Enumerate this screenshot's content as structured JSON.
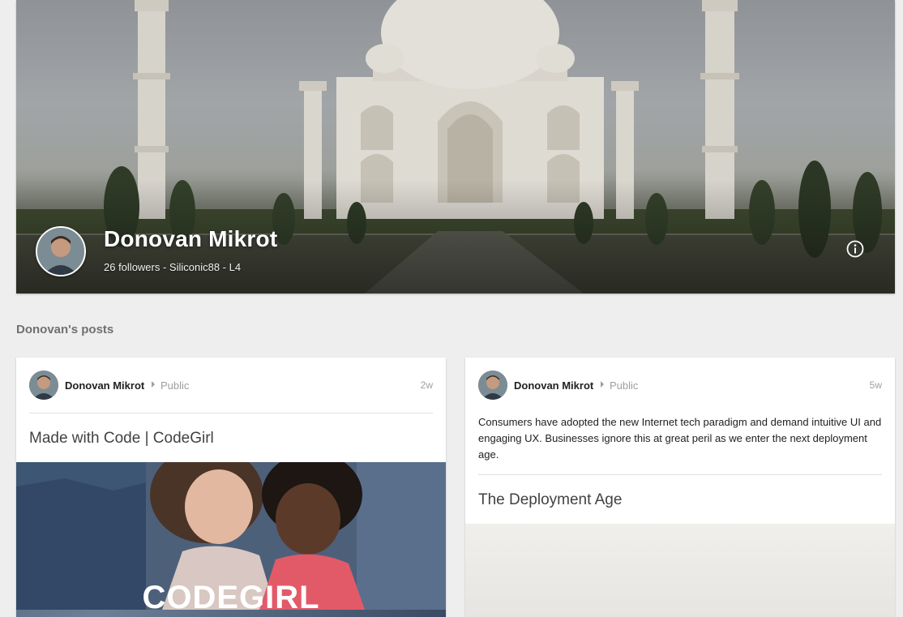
{
  "profile": {
    "name": "Donovan Mikrot",
    "subtitle": "26 followers - Siliconic88 - L4",
    "info_icon": "info-icon"
  },
  "posts_section": {
    "title": "Donovan's posts"
  },
  "posts": [
    {
      "author": "Donovan Mikrot",
      "visibility": "Public",
      "time": "2w",
      "link_title": "Made with Code | CodeGirl",
      "image_logo": "CODEGIRL"
    },
    {
      "author": "Donovan Mikrot",
      "visibility": "Public",
      "time": "5w",
      "text": "Consumers have adopted the new Internet tech paradigm and demand intuitive UI and engaging UX. Businesses ignore this at great peril as we enter the next deployment age.",
      "link_title": "The Deployment Age"
    }
  ]
}
